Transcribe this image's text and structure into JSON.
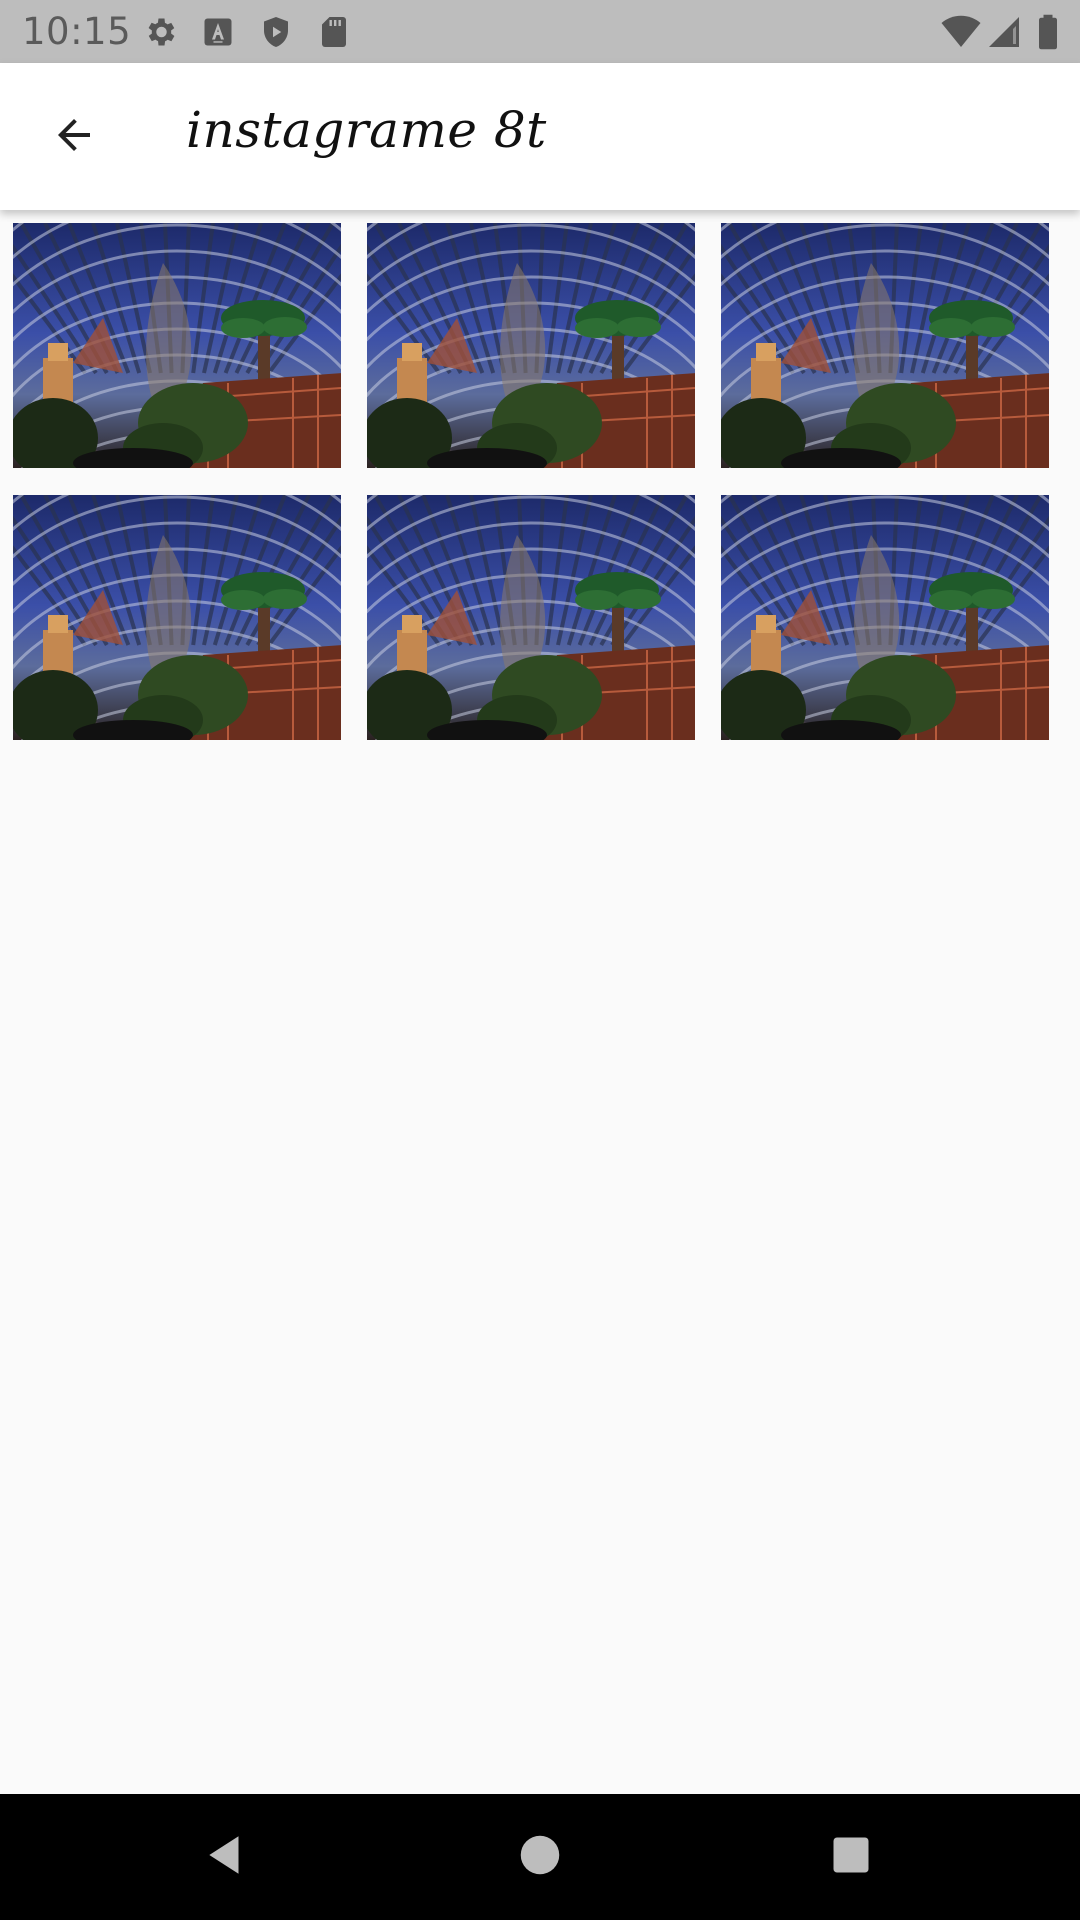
{
  "status_bar": {
    "time": "10:15",
    "icons": [
      "gear-icon",
      "font-icon",
      "shield-icon",
      "sd-card-icon",
      "wifi-icon",
      "signal-icon",
      "battery-icon"
    ]
  },
  "app_bar": {
    "title": "instagrame 8t",
    "back_icon": "arrow-back-icon"
  },
  "grid": {
    "columns": 3,
    "items": [
      {
        "image": "dome-interior-photo"
      },
      {
        "image": "dome-interior-photo"
      },
      {
        "image": "dome-interior-photo"
      },
      {
        "image": "dome-interior-photo"
      },
      {
        "image": "dome-interior-photo"
      },
      {
        "image": "dome-interior-photo"
      }
    ]
  },
  "nav_bar": {
    "buttons": [
      "back-triangle-icon",
      "home-circle-icon",
      "recents-square-icon"
    ]
  },
  "colors": {
    "status_bar_bg": "#bdbdbd",
    "app_bar_bg": "#ffffff",
    "content_bg": "#fafafa",
    "nav_bar_bg": "#000000"
  }
}
